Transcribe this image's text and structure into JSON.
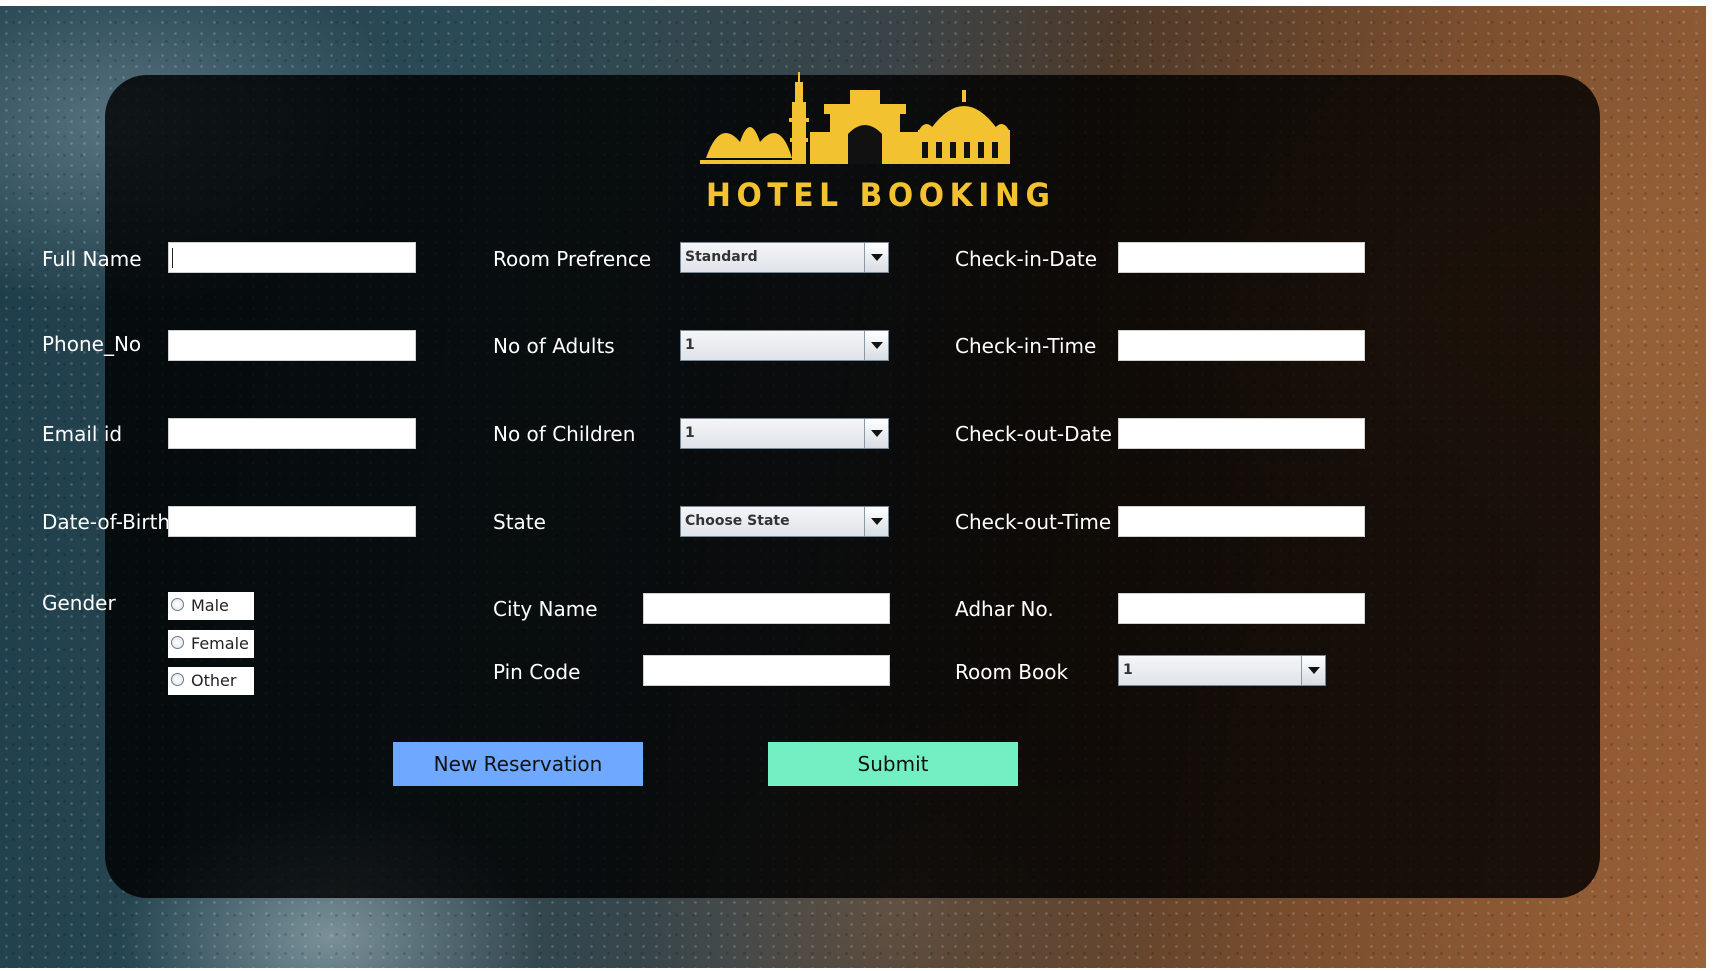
{
  "brand": {
    "name": "HOTEL BOOKING",
    "color": "#f2c230"
  },
  "left_column": {
    "full_name_label": "Full Name",
    "full_name_value": "",
    "phone_label": "Phone_No",
    "phone_value": "",
    "email_label": "Email id",
    "email_value": "",
    "dob_label": "Date-of-Birth",
    "dob_value": "",
    "gender_label": "Gender",
    "gender_options": [
      "Male",
      "Female",
      "Other"
    ]
  },
  "middle_column": {
    "room_pref_label": "Room Prefrence",
    "room_pref_value": "Standard",
    "adults_label": "No of Adults",
    "adults_value": "1",
    "children_label": "No of Children",
    "children_value": "1",
    "state_label": "State",
    "state_value": "Choose State",
    "city_label": "City Name",
    "city_value": "",
    "pin_label": "Pin Code",
    "pin_value": ""
  },
  "right_column": {
    "checkin_date_label": "Check-in-Date",
    "checkin_date_value": "",
    "checkin_time_label": "Check-in-Time",
    "checkin_time_value": "",
    "checkout_date_label": "Check-out-Date",
    "checkout_date_value": "",
    "checkout_time_label": "Check-out-Time",
    "checkout_time_value": "",
    "adhar_label": "Adhar No.",
    "adhar_value": "",
    "room_book_label": "Room Book",
    "room_book_value": "1"
  },
  "actions": {
    "new_reservation_label": "New Reservation",
    "new_reservation_color": "#6fa8ff",
    "submit_label": "Submit",
    "submit_color": "#72f0c4"
  }
}
